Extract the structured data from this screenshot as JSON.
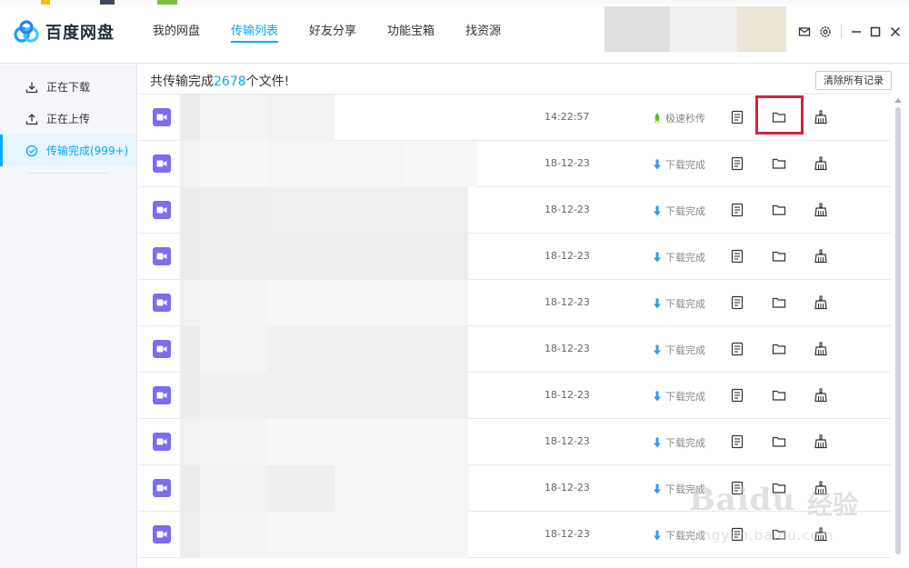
{
  "app": {
    "name": "百度网盘"
  },
  "nav": {
    "items": [
      {
        "label": "我的网盘",
        "active": false
      },
      {
        "label": "传输列表",
        "active": true
      },
      {
        "label": "好友分享",
        "active": false
      },
      {
        "label": "功能宝箱",
        "active": false
      },
      {
        "label": "找资源",
        "active": false
      }
    ]
  },
  "titlebar_icons": [
    "mail-icon",
    "settings-icon",
    "minimize-icon",
    "maximize-icon",
    "close-icon"
  ],
  "sidebar": {
    "items": [
      {
        "label": "正在下载",
        "icon": "download-icon",
        "active": false
      },
      {
        "label": "正在上传",
        "icon": "upload-icon",
        "active": false
      },
      {
        "label": "传输完成(999+)",
        "icon": "check-circle-icon",
        "active": true
      }
    ]
  },
  "main": {
    "summary_prefix": "共传输完成",
    "summary_count": "2678",
    "summary_suffix": "个文件!",
    "clear_button": "清除所有记录"
  },
  "rows": [
    {
      "time": "14:22:57",
      "status": "极速秒传",
      "status_icon": "rocket-icon"
    },
    {
      "time": "18-12-23",
      "status": "下载完成",
      "status_icon": "download-arrow-icon"
    },
    {
      "time": "18-12-23",
      "status": "下载完成",
      "status_icon": "download-arrow-icon"
    },
    {
      "time": "18-12-23",
      "status": "下载完成",
      "status_icon": "download-arrow-icon"
    },
    {
      "time": "18-12-23",
      "status": "下载完成",
      "status_icon": "download-arrow-icon"
    },
    {
      "time": "18-12-23",
      "status": "下载完成",
      "status_icon": "download-arrow-icon"
    },
    {
      "time": "18-12-23",
      "status": "下载完成",
      "status_icon": "download-arrow-icon"
    },
    {
      "time": "18-12-23",
      "status": "下载完成",
      "status_icon": "download-arrow-icon"
    },
    {
      "time": "18-12-23",
      "status": "下载完成",
      "status_icon": "download-arrow-icon"
    },
    {
      "time": "18-12-23",
      "status": "下载完成",
      "status_icon": "download-arrow-icon"
    }
  ],
  "watermark": {
    "brand": "Baidu",
    "cn": "经验",
    "url": "jingyan.baidu.com"
  },
  "colors": {
    "accent": "#06a7ff",
    "file_icon": "#7b6cf0",
    "highlight": "#d4213c",
    "rocket": "#52c41a",
    "download_arrow": "#2d9cf0"
  }
}
